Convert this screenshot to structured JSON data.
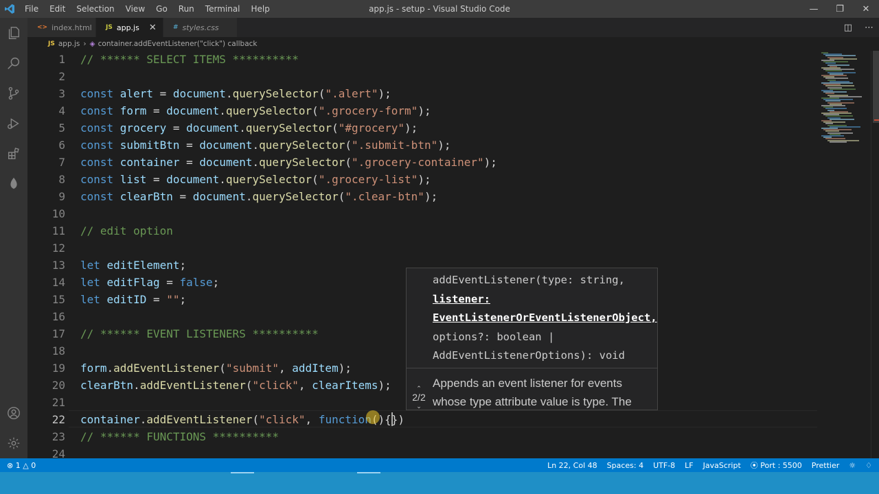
{
  "window": {
    "title": "app.js - setup - Visual Studio Code",
    "menu": [
      "File",
      "Edit",
      "Selection",
      "View",
      "Go",
      "Run",
      "Terminal",
      "Help"
    ]
  },
  "tabs": [
    {
      "label": "index.html",
      "icon": "html-file-icon",
      "icon_text": "<>",
      "icon_color": "#e37933",
      "active": false
    },
    {
      "label": "app.js",
      "icon": "js-file-icon",
      "icon_text": "JS",
      "icon_color": "#cbcb41",
      "active": true
    },
    {
      "label": "styles.css",
      "icon": "css-file-icon",
      "icon_text": "#",
      "icon_color": "#519aba",
      "active": false
    }
  ],
  "breadcrumb": {
    "file": "app.js",
    "file_icon": "JS",
    "symbol": "container.addEventListener(\"click\") callback"
  },
  "editor": {
    "current_line": 22,
    "lines": [
      {
        "n": "1",
        "t": [
          [
            "cmt",
            "// ****** SELECT ITEMS **********"
          ]
        ]
      },
      {
        "n": "2",
        "t": []
      },
      {
        "n": "3",
        "t": [
          [
            "kw",
            "const "
          ],
          [
            "var",
            "alert"
          ],
          [
            "plain",
            " = "
          ],
          [
            "var",
            "document"
          ],
          [
            "plain",
            "."
          ],
          [
            "fn",
            "querySelector"
          ],
          [
            "plain",
            "("
          ],
          [
            "str",
            "\".alert\""
          ],
          [
            "plain",
            ");"
          ]
        ]
      },
      {
        "n": "4",
        "t": [
          [
            "kw",
            "const "
          ],
          [
            "var",
            "form"
          ],
          [
            "plain",
            " = "
          ],
          [
            "var",
            "document"
          ],
          [
            "plain",
            "."
          ],
          [
            "fn",
            "querySelector"
          ],
          [
            "plain",
            "("
          ],
          [
            "str",
            "\".grocery-form\""
          ],
          [
            "plain",
            ");"
          ]
        ]
      },
      {
        "n": "5",
        "t": [
          [
            "kw",
            "const "
          ],
          [
            "var",
            "grocery"
          ],
          [
            "plain",
            " = "
          ],
          [
            "var",
            "document"
          ],
          [
            "plain",
            "."
          ],
          [
            "fn",
            "querySelector"
          ],
          [
            "plain",
            "("
          ],
          [
            "str",
            "\"#grocery\""
          ],
          [
            "plain",
            ");"
          ]
        ]
      },
      {
        "n": "6",
        "t": [
          [
            "kw",
            "const "
          ],
          [
            "var",
            "submitBtn"
          ],
          [
            "plain",
            " = "
          ],
          [
            "var",
            "document"
          ],
          [
            "plain",
            "."
          ],
          [
            "fn",
            "querySelector"
          ],
          [
            "plain",
            "("
          ],
          [
            "str",
            "\".submit-btn\""
          ],
          [
            "plain",
            ");"
          ]
        ]
      },
      {
        "n": "7",
        "t": [
          [
            "kw",
            "const "
          ],
          [
            "var",
            "container"
          ],
          [
            "plain",
            " = "
          ],
          [
            "var",
            "document"
          ],
          [
            "plain",
            "."
          ],
          [
            "fn",
            "querySelector"
          ],
          [
            "plain",
            "("
          ],
          [
            "str",
            "\".grocery-container\""
          ],
          [
            "plain",
            ");"
          ]
        ]
      },
      {
        "n": "8",
        "t": [
          [
            "kw",
            "const "
          ],
          [
            "var",
            "list"
          ],
          [
            "plain",
            " = "
          ],
          [
            "var",
            "document"
          ],
          [
            "plain",
            "."
          ],
          [
            "fn",
            "querySelector"
          ],
          [
            "plain",
            "("
          ],
          [
            "str",
            "\".grocery-list\""
          ],
          [
            "plain",
            ");"
          ]
        ]
      },
      {
        "n": "9",
        "t": [
          [
            "kw",
            "const "
          ],
          [
            "var",
            "clearBtn"
          ],
          [
            "plain",
            " = "
          ],
          [
            "var",
            "document"
          ],
          [
            "plain",
            "."
          ],
          [
            "fn",
            "querySelector"
          ],
          [
            "plain",
            "("
          ],
          [
            "str",
            "\".clear-btn\""
          ],
          [
            "plain",
            ");"
          ]
        ]
      },
      {
        "n": "10",
        "t": []
      },
      {
        "n": "11",
        "t": [
          [
            "cmt",
            "// edit option"
          ]
        ]
      },
      {
        "n": "12",
        "t": []
      },
      {
        "n": "13",
        "t": [
          [
            "kw",
            "let "
          ],
          [
            "var",
            "editElement"
          ],
          [
            "plain",
            ";"
          ]
        ]
      },
      {
        "n": "14",
        "t": [
          [
            "kw",
            "let "
          ],
          [
            "var",
            "editFlag"
          ],
          [
            "plain",
            " = "
          ],
          [
            "kw",
            "false"
          ],
          [
            "plain",
            ";"
          ]
        ]
      },
      {
        "n": "15",
        "t": [
          [
            "kw",
            "let "
          ],
          [
            "var",
            "editID"
          ],
          [
            "plain",
            " = "
          ],
          [
            "str",
            "\"\""
          ],
          [
            "plain",
            ";"
          ]
        ]
      },
      {
        "n": "16",
        "t": []
      },
      {
        "n": "17",
        "t": [
          [
            "cmt",
            "// ****** EVENT LISTENERS **********"
          ]
        ]
      },
      {
        "n": "18",
        "t": []
      },
      {
        "n": "19",
        "t": [
          [
            "var",
            "form"
          ],
          [
            "plain",
            "."
          ],
          [
            "fn",
            "addEventListener"
          ],
          [
            "plain",
            "("
          ],
          [
            "str",
            "\"submit\""
          ],
          [
            "plain",
            ", "
          ],
          [
            "var",
            "addItem"
          ],
          [
            "plain",
            ");"
          ]
        ]
      },
      {
        "n": "20",
        "t": [
          [
            "var",
            "clearBtn"
          ],
          [
            "plain",
            "."
          ],
          [
            "fn",
            "addEventListener"
          ],
          [
            "plain",
            "("
          ],
          [
            "str",
            "\"click\""
          ],
          [
            "plain",
            ", "
          ],
          [
            "var",
            "clearItems"
          ],
          [
            "plain",
            ");"
          ]
        ]
      },
      {
        "n": "21",
        "t": []
      },
      {
        "n": "22",
        "t": [
          [
            "var",
            "container"
          ],
          [
            "plain",
            "."
          ],
          [
            "fn",
            "addEventListener"
          ],
          [
            "plain",
            "("
          ],
          [
            "str",
            "\"click\""
          ],
          [
            "plain",
            ", "
          ],
          [
            "kw",
            "function"
          ],
          [
            "plain",
            "(){}"
          ],
          [
            "plain",
            ")"
          ]
        ]
      },
      {
        "n": "23",
        "t": [
          [
            "cmt",
            "// ****** FUNCTIONS **********"
          ]
        ]
      },
      {
        "n": "24",
        "t": []
      }
    ]
  },
  "hover": {
    "sig_l1": "addEventListener(type: string,",
    "sig_l2": "listener:",
    "sig_l3": "EventListenerOrEventListenerObject,",
    "sig_l4": "options?: boolean |",
    "sig_l5": "AddEventListenerOptions): void",
    "counter": "2/2",
    "doc_l1": "Appends an event listener for events",
    "doc_l2": "whose type attribute value is type. The"
  },
  "statusbar": {
    "errors": "1",
    "warnings": "0",
    "position": "Ln 22, Col 48",
    "spaces": "Spaces: 4",
    "encoding": "UTF-8",
    "eol": "LF",
    "language": "JavaScript",
    "port": "Port : 5500",
    "formatter": "Prettier"
  }
}
